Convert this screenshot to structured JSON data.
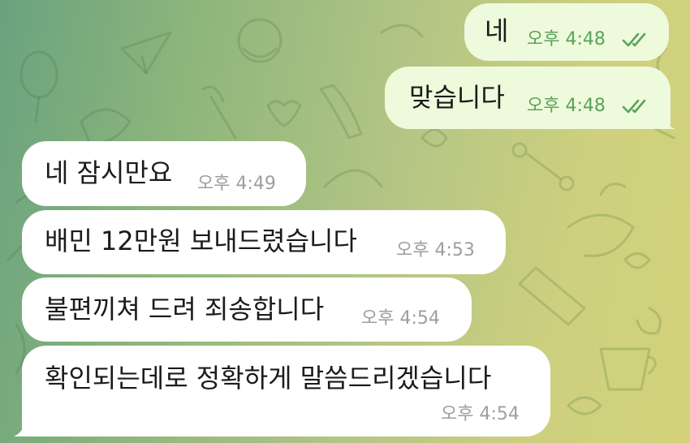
{
  "messages": [
    {
      "direction": "outgoing",
      "text": "네",
      "time": "오후 4:48",
      "status": "read-double-check-icon"
    },
    {
      "direction": "outgoing",
      "text": "맞습니다",
      "time": "오후 4:48",
      "status": "read-double-check-icon"
    },
    {
      "direction": "incoming",
      "text": "네 잠시만요",
      "time": "오후 4:49"
    },
    {
      "direction": "incoming",
      "text": "배민 12만원 보내드렸습니다",
      "time": "오후 4:53"
    },
    {
      "direction": "incoming",
      "text": "불편끼쳐 드려 죄송합니다",
      "time": "오후 4:54"
    },
    {
      "direction": "incoming",
      "text": "확인되는데로 정확하게 말씀드리겠습니다",
      "time": "오후 4:54"
    }
  ],
  "colors": {
    "outgoing_bubble": "#eefadc",
    "incoming_bubble": "#ffffff",
    "outgoing_meta": "#5aa35a",
    "incoming_meta": "#9e9e9e"
  }
}
